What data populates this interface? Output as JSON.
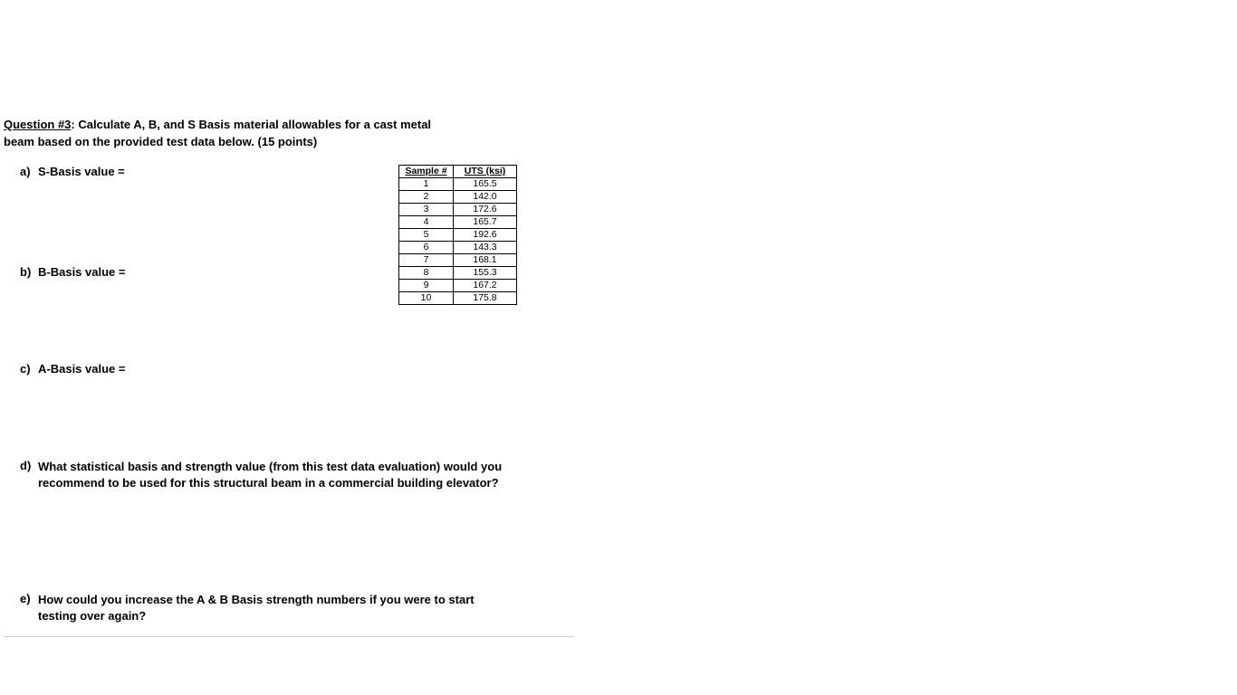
{
  "question": {
    "header_underlined": "Question #3",
    "header_rest": ": Calculate A, B, and S Basis material allowables for a cast metal",
    "header_line2": "beam based on the provided test data below. (15 points)"
  },
  "parts": {
    "a": {
      "label": "a)",
      "text": "S-Basis value ="
    },
    "b": {
      "label": "b)",
      "text": "B-Basis value ="
    },
    "c": {
      "label": "c)",
      "text": "A-Basis value ="
    },
    "d": {
      "label": "d)",
      "text": "What statistical basis and strength value (from this test data evaluation) would you recommend to be used for this structural beam in a commercial building elevator?"
    },
    "e": {
      "label": "e)",
      "text": "How could you increase the A & B Basis strength numbers if you were to start testing over again?"
    }
  },
  "table": {
    "headers": {
      "col1": "Sample #",
      "col2": "UTS (ksi)"
    },
    "rows": [
      {
        "sample": "1",
        "uts": "165.5"
      },
      {
        "sample": "2",
        "uts": "142.0"
      },
      {
        "sample": "3",
        "uts": "172.6"
      },
      {
        "sample": "4",
        "uts": "165.7"
      },
      {
        "sample": "5",
        "uts": "192.6"
      },
      {
        "sample": "6",
        "uts": "143.3"
      },
      {
        "sample": "7",
        "uts": "168.1"
      },
      {
        "sample": "8",
        "uts": "155.3"
      },
      {
        "sample": "9",
        "uts": "167.2"
      },
      {
        "sample": "10",
        "uts": "175.8"
      }
    ]
  }
}
